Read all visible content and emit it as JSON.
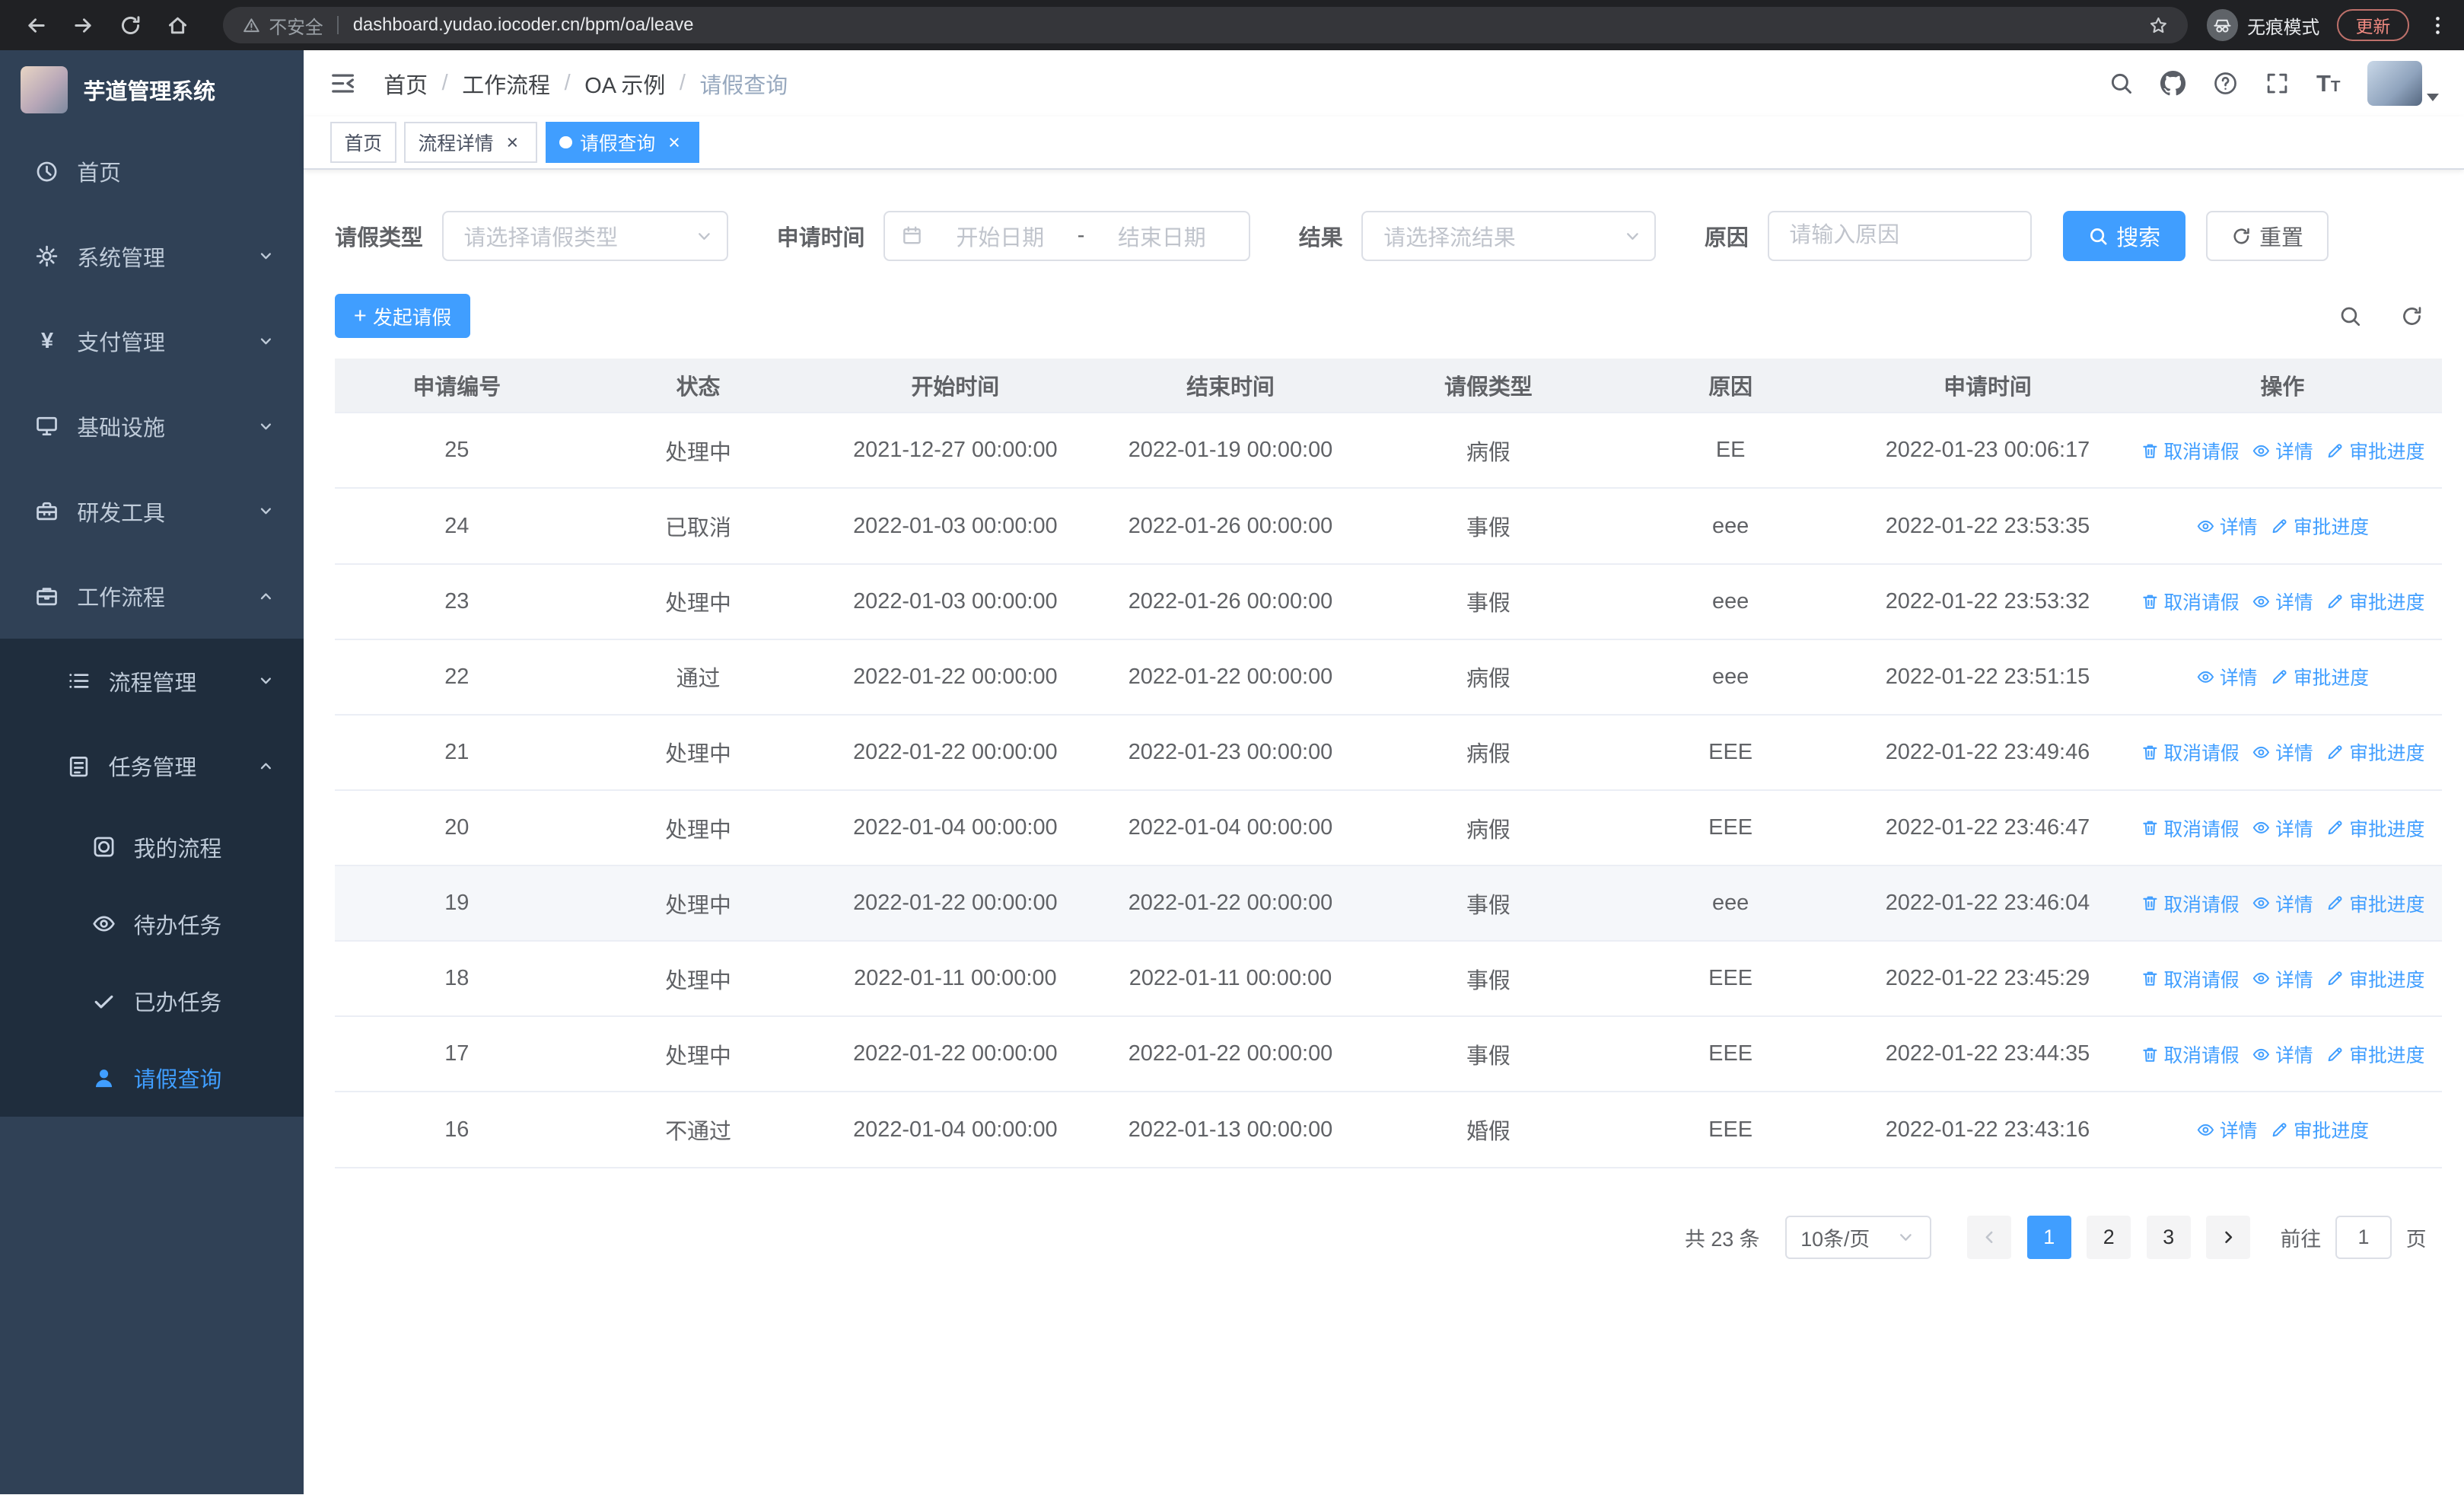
{
  "colors": {
    "primary": "#409eff",
    "sidebar_bg": "#304156",
    "sidebar_submenu_bg": "#1f2d3d",
    "chrome_bg": "#202124",
    "table_header_bg": "#f0f2f5",
    "row_highlight_bg": "#f5f7fa",
    "update_badge": "#f28b82"
  },
  "browser": {
    "security_label": "不安全",
    "url": "dashboard.yudao.iocoder.cn/bpm/oa/leave",
    "incognito_label": "无痕模式",
    "update_label": "更新"
  },
  "sidebar": {
    "app_title": "芋道管理系统",
    "items": [
      {
        "label": "首页"
      },
      {
        "label": "系统管理"
      },
      {
        "label": "支付管理"
      },
      {
        "label": "基础设施"
      },
      {
        "label": "研发工具"
      },
      {
        "label": "工作流程"
      },
      {
        "label": "流程管理"
      },
      {
        "label": "任务管理"
      },
      {
        "label": "我的流程"
      },
      {
        "label": "待办任务"
      },
      {
        "label": "已办任务"
      },
      {
        "label": "请假查询"
      }
    ],
    "pay_icon_glyph": "¥"
  },
  "breadcrumb": {
    "items": [
      "首页",
      "工作流程",
      "OA 示例",
      "请假查询"
    ],
    "separator": "/"
  },
  "tabs": [
    {
      "label": "首页",
      "close": ""
    },
    {
      "label": "流程详情",
      "close": "×"
    },
    {
      "label": "请假查询",
      "close": "×"
    }
  ],
  "filters": {
    "leave_type_label": "请假类型",
    "leave_type_placeholder": "请选择请假类型",
    "apply_time_label": "申请时间",
    "start_date_placeholder": "开始日期",
    "range_separator": "-",
    "end_date_placeholder": "结束日期",
    "result_label": "结果",
    "result_placeholder": "请选择流结果",
    "reason_label": "原因",
    "reason_placeholder": "请输入原因",
    "search_label": "搜索",
    "reset_label": "重置"
  },
  "toolbar": {
    "create_label": "发起请假",
    "plus_glyph": "+"
  },
  "table": {
    "headers": [
      "申请编号",
      "状态",
      "开始时间",
      "结束时间",
      "请假类型",
      "原因",
      "申请时间",
      "操作"
    ],
    "actions": {
      "cancel": "取消请假",
      "detail": "详情",
      "progress": "审批进度"
    },
    "rows": [
      {
        "id": "25",
        "status": "处理中",
        "start": "2021-12-27 00:00:00",
        "end": "2022-01-19 00:00:00",
        "type": "病假",
        "reason": "EE",
        "applied": "2022-01-23 00:06:17",
        "cancellable": true,
        "highlight": false
      },
      {
        "id": "24",
        "status": "已取消",
        "start": "2022-01-03 00:00:00",
        "end": "2022-01-26 00:00:00",
        "type": "事假",
        "reason": "eee",
        "applied": "2022-01-22 23:53:35",
        "cancellable": false,
        "highlight": false
      },
      {
        "id": "23",
        "status": "处理中",
        "start": "2022-01-03 00:00:00",
        "end": "2022-01-26 00:00:00",
        "type": "事假",
        "reason": "eee",
        "applied": "2022-01-22 23:53:32",
        "cancellable": true,
        "highlight": false
      },
      {
        "id": "22",
        "status": "通过",
        "start": "2022-01-22 00:00:00",
        "end": "2022-01-22 00:00:00",
        "type": "病假",
        "reason": "eee",
        "applied": "2022-01-22 23:51:15",
        "cancellable": false,
        "highlight": false
      },
      {
        "id": "21",
        "status": "处理中",
        "start": "2022-01-22 00:00:00",
        "end": "2022-01-23 00:00:00",
        "type": "病假",
        "reason": "EEE",
        "applied": "2022-01-22 23:49:46",
        "cancellable": true,
        "highlight": false
      },
      {
        "id": "20",
        "status": "处理中",
        "start": "2022-01-04 00:00:00",
        "end": "2022-01-04 00:00:00",
        "type": "病假",
        "reason": "EEE",
        "applied": "2022-01-22 23:46:47",
        "cancellable": true,
        "highlight": false
      },
      {
        "id": "19",
        "status": "处理中",
        "start": "2022-01-22 00:00:00",
        "end": "2022-01-22 00:00:00",
        "type": "事假",
        "reason": "eee",
        "applied": "2022-01-22 23:46:04",
        "cancellable": true,
        "highlight": true
      },
      {
        "id": "18",
        "status": "处理中",
        "start": "2022-01-11 00:00:00",
        "end": "2022-01-11 00:00:00",
        "type": "事假",
        "reason": "EEE",
        "applied": "2022-01-22 23:45:29",
        "cancellable": true,
        "highlight": false
      },
      {
        "id": "17",
        "status": "处理中",
        "start": "2022-01-22 00:00:00",
        "end": "2022-01-22 00:00:00",
        "type": "事假",
        "reason": "EEE",
        "applied": "2022-01-22 23:44:35",
        "cancellable": true,
        "highlight": false
      },
      {
        "id": "16",
        "status": "不通过",
        "start": "2022-01-04 00:00:00",
        "end": "2022-01-13 00:00:00",
        "type": "婚假",
        "reason": "EEE",
        "applied": "2022-01-22 23:43:16",
        "cancellable": false,
        "highlight": false
      }
    ]
  },
  "pagination": {
    "total": "共 23 条",
    "page_size": "10条/页",
    "pages": [
      "1",
      "2",
      "3"
    ],
    "active_page": "1",
    "goto_label": "前往",
    "goto_value": "1",
    "page_label": "页"
  }
}
